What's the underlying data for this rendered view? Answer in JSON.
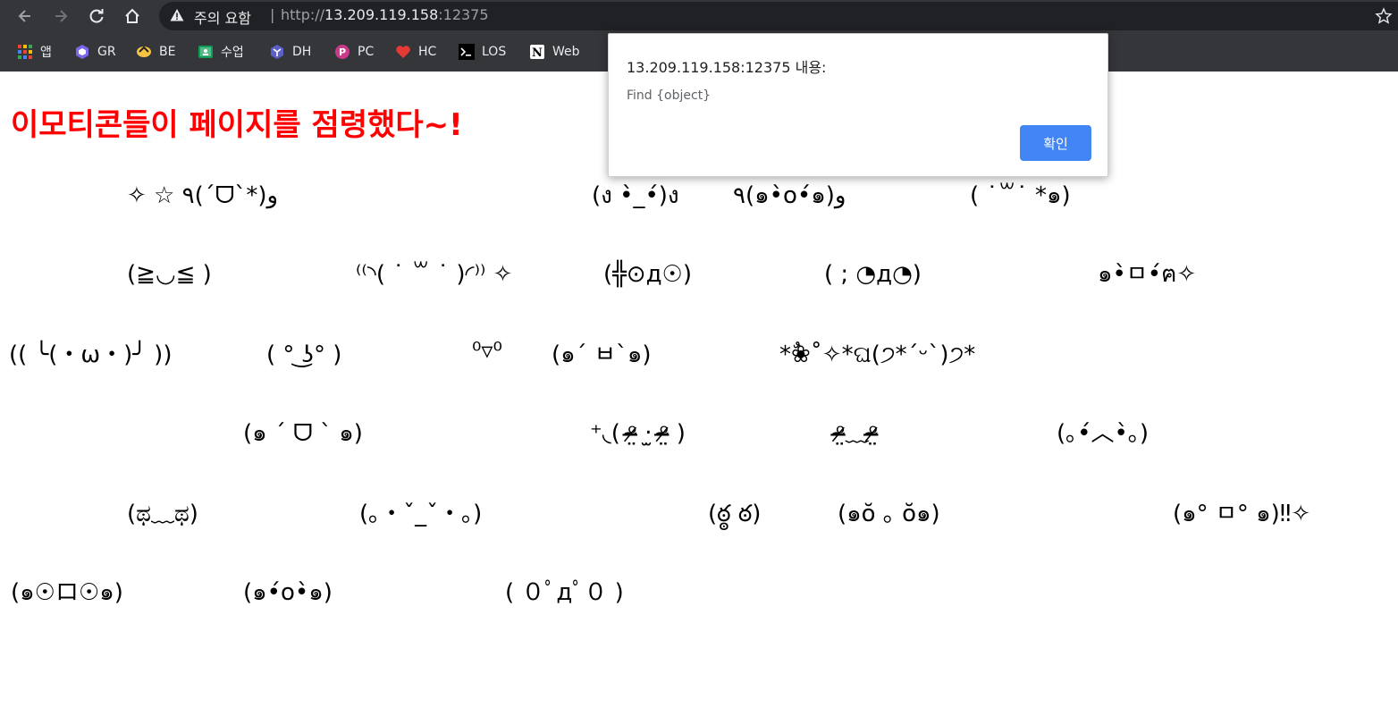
{
  "browser": {
    "security_label": "주의 요함",
    "url_scheme": "http://",
    "url_host": "13.209.119.158",
    "url_port": ":12375",
    "bookmarks": [
      {
        "label": "앱",
        "icon": "apps-grid-icon"
      },
      {
        "label": "GR",
        "icon": "gr-logo-icon"
      },
      {
        "label": "BE",
        "icon": "be-logo-icon"
      },
      {
        "label": "수업",
        "icon": "classroom-icon"
      },
      {
        "label": "DH",
        "icon": "dh-logo-icon"
      },
      {
        "label": "PC",
        "icon": "pc-logo-icon"
      },
      {
        "label": "HC",
        "icon": "heart-icon"
      },
      {
        "label": "LOS",
        "icon": "terminal-icon"
      },
      {
        "label": "Web",
        "icon": "notion-icon"
      }
    ]
  },
  "page": {
    "title": "이모티콘들이 페이지를 점령했다~!",
    "emoticons": [
      "✧ ☆ ٩(ˊᗜˋ*)و",
      "(ง •̀_•́)ง",
      "٩(๑•̀o•́๑)و",
      "( ˙꒳​˙ *๑)",
      "(≧◡≦ )",
      "⁽⁽◝( ˙ ꒳ ˙ )◜⁾⁾ ✧",
      "(╬⊙д☉)",
      "( ; ◔д◔)",
      "๑•̀ㅁ•́ฅ✧",
      "(( ╰(・ω・)╯ ))",
      "( ° ͜ʖ° )",
      "⁰▿⁰",
      "(๑´ ㅂ`๑)",
      "*❀ٌ˚✧*ଘ(੭*ˊᵕˋ)੭*",
      "(๑ ˊ ᗜ ˋ ๑)",
      "⁺◟( ᵒ̴̶̷̤ ‧̫ ᵒ̴̶̷̤ )",
      "ᵒ̴̶̷̤﹏ᵒ̴̶̷̤",
      "(｡•́︿•̀｡)",
      "(ಥ﹏ಥ)",
      "(｡・ˇ_ˇ・｡)",
      "(ఠ్ఠ ఠ)",
      "(๑ŏ ｡ ŏ๑)",
      "(๑° ㅁ° ๑)‼✧",
      "(๑☉ロ☉๑)",
      "(๑•́o•̀๑)",
      "( ０ﾟдﾟ０ )"
    ]
  },
  "dialog": {
    "title": "13.209.119.158:12375 내용:",
    "message": "Find {object}",
    "ok_label": "확인"
  }
}
